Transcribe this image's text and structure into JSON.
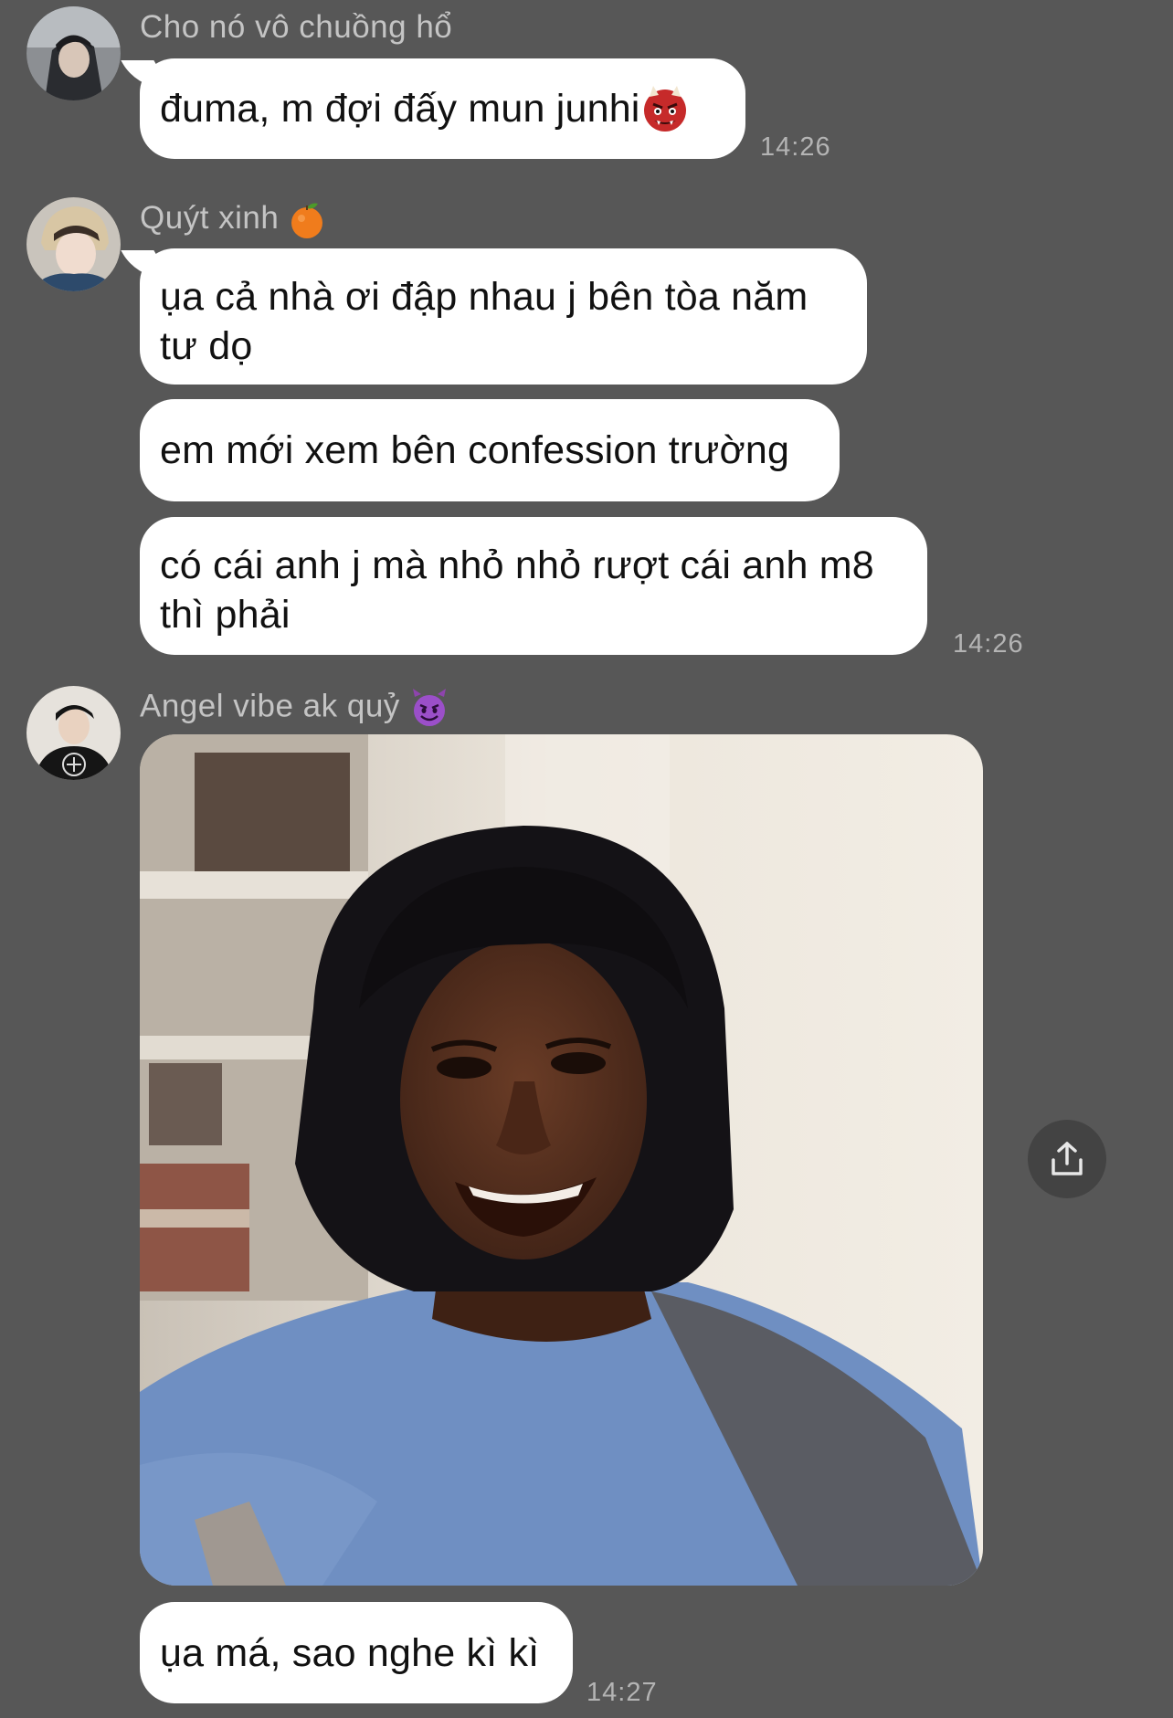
{
  "messages": [
    {
      "sender": "Cho nó vô chuồng hổ",
      "bubbles": [
        {
          "text": "đuma, m đợi đấy mun junhi",
          "emoji": "oni-icon"
        }
      ],
      "time": "14:26"
    },
    {
      "sender": "Quýt xinh",
      "sender_emoji": "tangerine-icon",
      "bubbles": [
        {
          "text": "ụa cả nhà ơi đập nhau j bên tòa năm tư dọ"
        },
        {
          "text": "em mới xem bên confession trường"
        },
        {
          "text": "có cái anh j mà nhỏ nhỏ rượt cái anh m8 thì phải"
        }
      ],
      "time": "14:26"
    },
    {
      "sender": "Angel vibe ak quỷ",
      "sender_emoji": "smiling-devil-icon",
      "image": "selfie-meme-photo",
      "bubbles": [
        {
          "text": "ụa má, sao nghe kì kì"
        }
      ],
      "time": "14:27"
    }
  ],
  "actions": {
    "share_icon": "share-icon"
  },
  "colors": {
    "background": "#575757",
    "bubble": "#ffffff",
    "name_text": "#c4c4c4",
    "time_text": "#b4b4b4"
  }
}
